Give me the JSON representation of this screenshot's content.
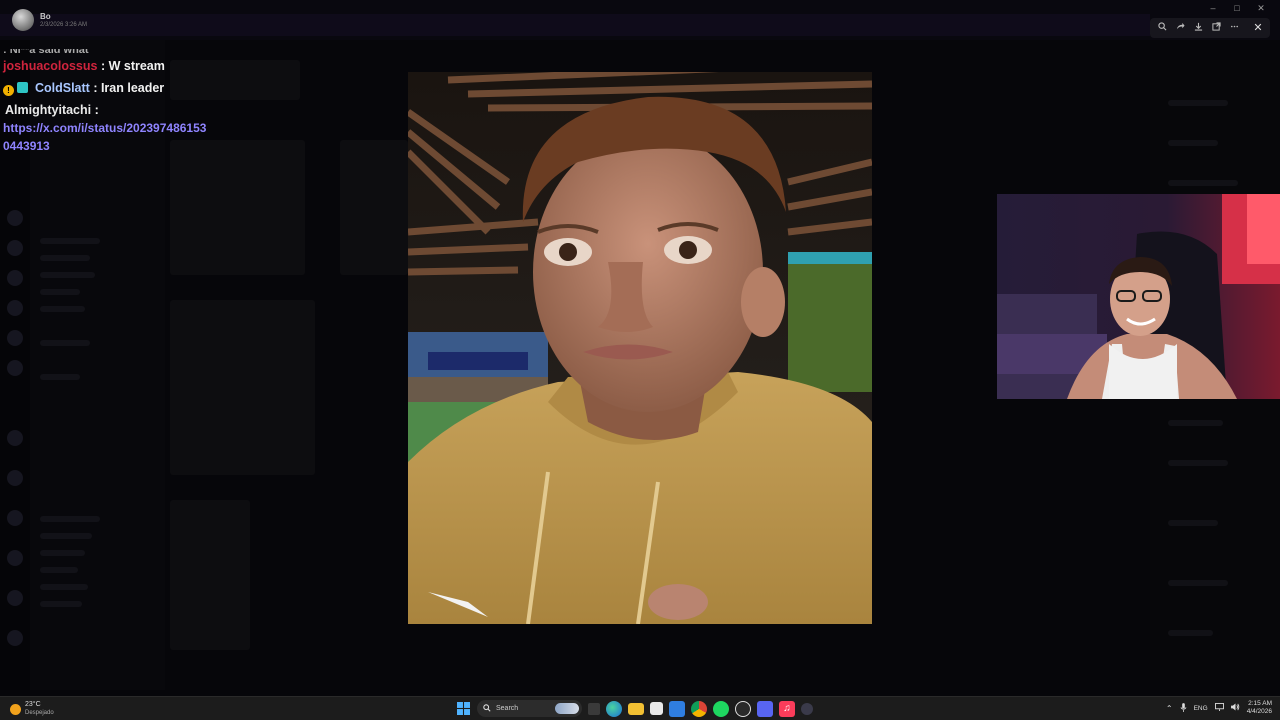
{
  "viewer": {
    "user_name": "Bo",
    "timestamp": "2/3/2026 3:26 AM"
  },
  "window": {
    "controls": [
      "–",
      "□",
      "✕"
    ],
    "toolbar_icons": [
      "zoom-icon",
      "share-icon",
      "download-icon",
      "open-external-icon",
      "more-icon"
    ],
    "close_label": "✕"
  },
  "chat": {
    "partial_top": ": Ni**a said what",
    "messages": [
      {
        "user": "joshuacolossus",
        "text": ": W stream",
        "color": "#d0243d"
      },
      {
        "user": "ColdSlatt",
        "text": ": Iran leader",
        "color": "#a9c7ff"
      },
      {
        "user": "Almightyitachi",
        "text": ":",
        "color": "#eaeaea",
        "link": "https://x.com/i/status/2023974861530443913"
      }
    ]
  },
  "taskbar": {
    "weather_temp": "23°C",
    "weather_desc": "Despejado",
    "search_label": "Search",
    "language": "ENG",
    "time": "2:15 AM",
    "date": "4/4/2026"
  }
}
